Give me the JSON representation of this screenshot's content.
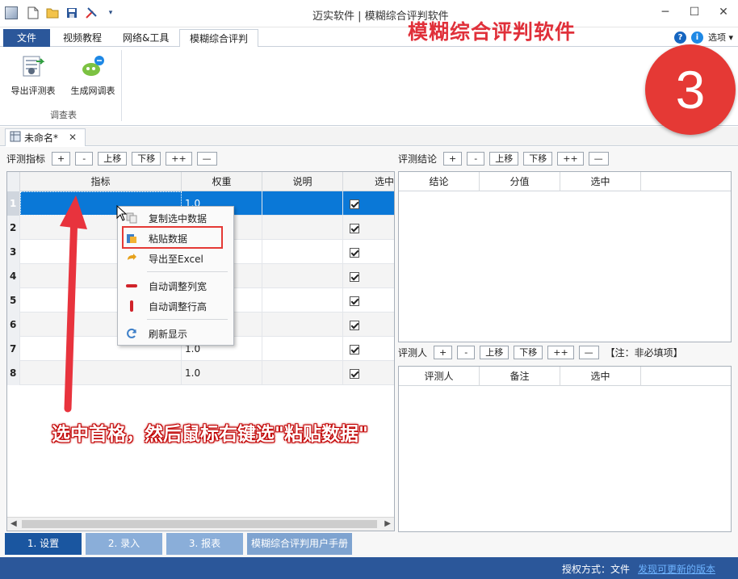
{
  "window": {
    "title": "迈实软件 | 模糊综合评判软件",
    "minimize": "─",
    "maximize": "☐",
    "close": "✕"
  },
  "overlay": {
    "title": "模糊综合评判软件",
    "step": "3",
    "annotation": "选中首格，然后鼠标右键选\"粘贴数据\""
  },
  "ribbon": {
    "tabs": [
      "文件",
      "视频教程",
      "网络&工具",
      "模糊综合评判"
    ],
    "options_label": "选项",
    "buttons": [
      {
        "label": "导出评测表"
      },
      {
        "label": "生成网调表"
      }
    ],
    "group_label": "调查表"
  },
  "document": {
    "tab_label": "未命名*"
  },
  "left_panel": {
    "toolbar": {
      "label": "评测指标",
      "buttons": [
        "+",
        "-",
        "上移",
        "下移",
        "++",
        "—"
      ]
    },
    "columns": [
      "指标",
      "权重",
      "说明",
      "选中"
    ],
    "rows": [
      {
        "num": "1",
        "weight": "1.0",
        "checked": true
      },
      {
        "num": "2",
        "weight": "",
        "checked": true
      },
      {
        "num": "3",
        "weight": "",
        "checked": true
      },
      {
        "num": "4",
        "weight": "",
        "checked": true
      },
      {
        "num": "5",
        "weight": "",
        "checked": true
      },
      {
        "num": "6",
        "weight": "",
        "checked": true
      },
      {
        "num": "7",
        "weight": "1.0",
        "checked": true
      },
      {
        "num": "8",
        "weight": "1.0",
        "checked": true
      }
    ]
  },
  "conclusion_panel": {
    "toolbar": {
      "label": "评测结论",
      "buttons": [
        "+",
        "-",
        "上移",
        "下移",
        "++",
        "—"
      ]
    },
    "columns": [
      "结论",
      "分值",
      "选中"
    ]
  },
  "evaluator_panel": {
    "toolbar": {
      "label": "评测人",
      "buttons": [
        "+",
        "-",
        "上移",
        "下移",
        "++",
        "—"
      ],
      "note": "【注：非必填项】"
    },
    "columns": [
      "评测人",
      "备注",
      "选中"
    ]
  },
  "context_menu": {
    "items": [
      {
        "label": "复制选中数据",
        "icon": "copy-icon"
      },
      {
        "label": "粘贴数据",
        "icon": "paste-icon"
      },
      {
        "label": "导出至Excel",
        "icon": "export-icon"
      },
      {
        "label": "自动调整列宽",
        "icon": "column-width-icon"
      },
      {
        "label": "自动调整行高",
        "icon": "row-height-icon"
      },
      {
        "label": "刷新显示",
        "icon": "refresh-icon"
      }
    ]
  },
  "bottom_nav": [
    "1. 设置",
    "2. 录入",
    "3. 报表",
    "模糊综合评判用户手册"
  ],
  "status": {
    "license_label": "授权方式：文件",
    "update_link": "发现可更新的版本"
  },
  "colors": {
    "accent": "#2b579a",
    "selection": "#0a78d7",
    "annotation_red": "#e53935"
  }
}
